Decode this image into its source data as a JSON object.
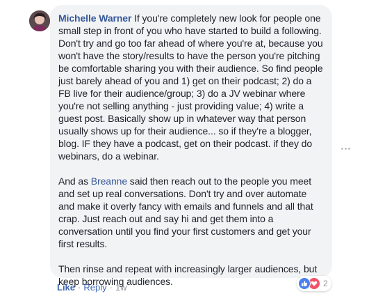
{
  "comment": {
    "author": "Michelle Warner",
    "text_intro": " If you're completely new look for people one small step in front of you who have started to build a following. Don't try and go too far ahead of where you're at, because you won't have the story/results to have the person you're pitching be comfortable sharing you with their audience. So find people just barely ahead of you and 1) get on their podcast; 2) do a FB live for their audience/group; 3) do a JV webinar where you're not selling anything - just providing value; 4) write a guest post. Basically show up in whatever way that person usually shows up for their audience... so if they're a blogger, blog. IF they have a podcast, get on their podcast. if they do webinars, do a webinar.",
    "para2_prefix": "And as ",
    "mention": "Breanne",
    "para2_rest": " said then reach out to the people you meet and set up real conversations. Don't try and over automate and make it overly fancy with emails and funnels and all that crap. Just reach out and say hi and get them into a conversation until you find your first customers and get your first results.",
    "para3": "Then rinse and repeat with increasingly larger audiences, but keep borrowing audiences."
  },
  "actions": {
    "like_label": "Like",
    "separator": "·",
    "reply_label": "Reply",
    "timestamp": "1w"
  },
  "reactions": {
    "icons": [
      "like-icon",
      "love-icon"
    ],
    "count": "2",
    "like_color": "#4a7ff0",
    "love_color": "#f25268"
  },
  "colors": {
    "link": "#365899",
    "bubble": "#f2f3f5",
    "text": "#1d2129",
    "meta": "#90949c"
  }
}
